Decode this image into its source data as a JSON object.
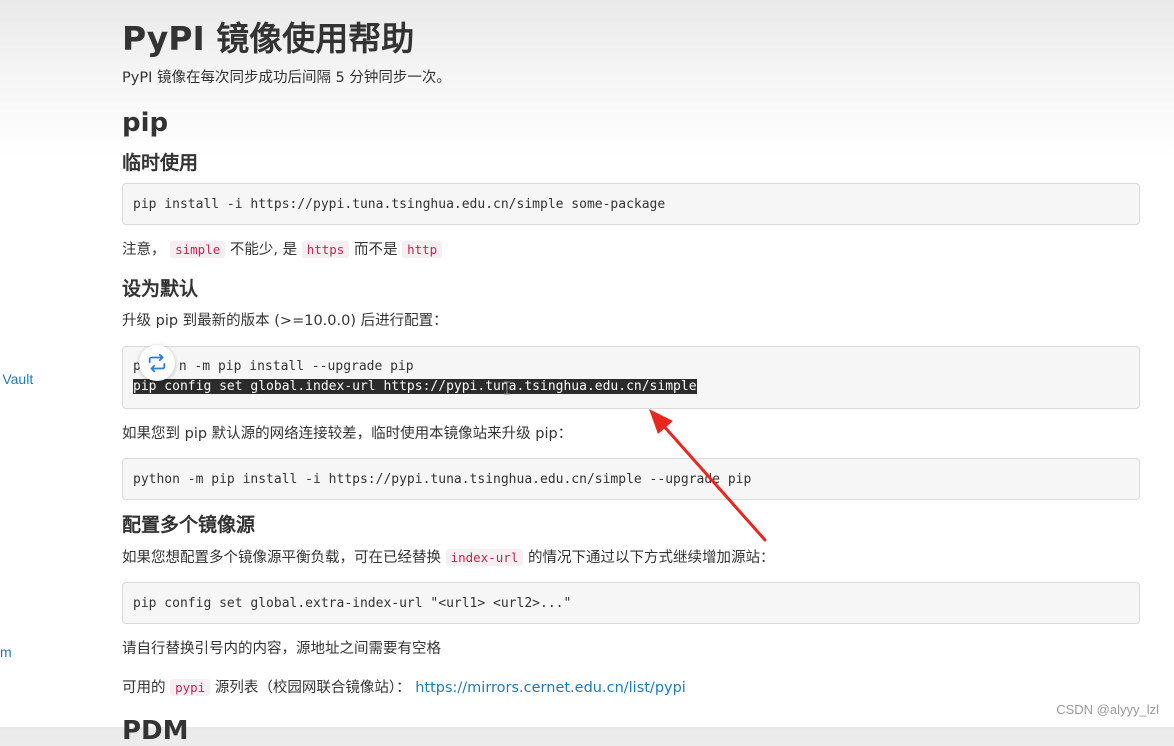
{
  "sidebar": {
    "fragment_1": " Vault",
    "fragment_2": "m"
  },
  "page": {
    "title": "PyPI 镜像使用帮助",
    "subtitle": "PyPI 镜像在每次同步成功后间隔 5 分钟同步一次。"
  },
  "pip_section": {
    "heading": "pip",
    "temp_use": {
      "heading": "临时使用",
      "code": "pip install -i https://pypi.tuna.tsinghua.edu.cn/simple some-package",
      "note_prefix": "注意，",
      "note_code_1": "simple",
      "note_mid": "不能少, 是",
      "note_code_2": "https",
      "note_mid_2": "而不是",
      "note_code_3": "http"
    },
    "set_default": {
      "heading": "设为默认",
      "text": "升级 pip 到最新的版本 (>=10.0.0) 后进行配置：",
      "code_line_1_start": "p",
      "code_line_1_end": "n -m pip install --upgrade pip",
      "code_line_2": "pip config set global.index-url https://pypi.tuna.tsinghua.edu.cn/simple",
      "text_2": "如果您到 pip 默认源的网络连接较差，临时使用本镜像站来升级 pip：",
      "code_2": "python -m pip install -i https://pypi.tuna.tsinghua.edu.cn/simple --upgrade pip"
    },
    "multi_mirror": {
      "heading": "配置多个镜像源",
      "text_prefix": "如果您想配置多个镜像源平衡负载，可在已经替换",
      "text_code": "index-url",
      "text_suffix": "的情况下通过以下方式继续增加源站：",
      "code": "pip config set global.extra-index-url \"<url1> <url2>...\"",
      "note": "请自行替换引号内的内容，源地址之间需要有空格",
      "list_prefix": "可用的",
      "list_code": "pypi",
      "list_mid": "源列表（校园网联合镜像站）：",
      "list_link": "https://mirrors.cernet.edu.cn/list/pypi"
    }
  },
  "next_heading_cut": "PDM",
  "overlay": {
    "repeat_icon": "repeat-icon",
    "arrow_color": "#e8271f",
    "highlight_bg": "#2b2b2b"
  },
  "watermark": "CSDN @alyyy_lzl"
}
